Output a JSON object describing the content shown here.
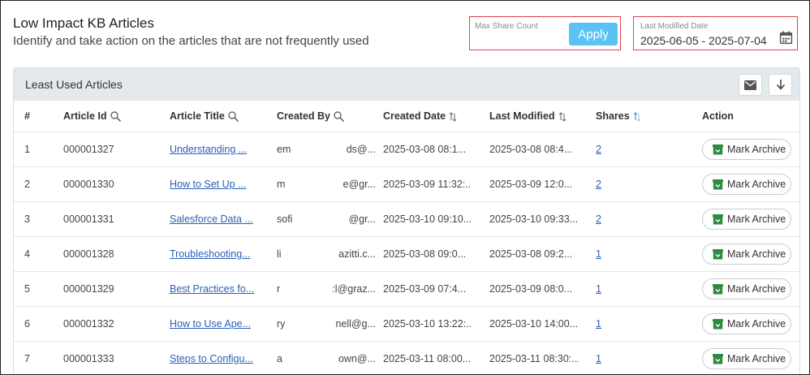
{
  "header": {
    "title": "Low Impact KB Articles",
    "subtitle": "Identify and take action on the articles that are not frequently used"
  },
  "filters": {
    "max_share_label": "Max Share Count",
    "max_share_value": "",
    "apply_label": "Apply",
    "date_label": "Last Modified Date",
    "date_range": "2025-06-05 - 2025-07-04"
  },
  "panel": {
    "title": "Least Used Articles",
    "columns": [
      "#",
      "Article Id",
      "Article Title",
      "Created By",
      "Created Date",
      "Last Modified",
      "Shares",
      "Action"
    ],
    "action_label": "Mark Archive",
    "rows": [
      {
        "num": "1",
        "id": "000001327",
        "title": "Understanding ...",
        "created_by_a": "em",
        "created_by_b": "ds@...",
        "created": "2025-03-08 08:1...",
        "modified": "2025-03-08 08:4...",
        "shares": "2"
      },
      {
        "num": "2",
        "id": "000001330",
        "title": "How to Set Up ...",
        "created_by_a": "m",
        "created_by_b": "e@gr...",
        "created": "2025-03-09 11:32:...",
        "modified": "2025-03-09 12:0...",
        "shares": "2"
      },
      {
        "num": "3",
        "id": "000001331",
        "title": "Salesforce Data ...",
        "created_by_a": "sofi",
        "created_by_b": "@gr...",
        "created": "2025-03-10 09:10...",
        "modified": "2025-03-10 09:33...",
        "shares": "2"
      },
      {
        "num": "4",
        "id": "000001328",
        "title": "Troubleshooting...",
        "created_by_a": "li",
        "created_by_b": "azitti.c...",
        "created": "2025-03-08 09:0...",
        "modified": "2025-03-08 09:2...",
        "shares": "1"
      },
      {
        "num": "5",
        "id": "000001329",
        "title": "Best Practices fo...",
        "created_by_a": "r",
        "created_by_b": ":l@graz...",
        "created": "2025-03-09 07:4...",
        "modified": "2025-03-09 08:0...",
        "shares": "1"
      },
      {
        "num": "6",
        "id": "000001332",
        "title": "How to Use Ape...",
        "created_by_a": "ry",
        "created_by_b": "nell@g...",
        "created": "2025-03-10 13:22:...",
        "modified": "2025-03-10 14:00...",
        "shares": "1"
      },
      {
        "num": "7",
        "id": "000001333",
        "title": "Steps to Configu...",
        "created_by_a": "a",
        "created_by_b": "own@...",
        "created": "2025-03-11 08:00...",
        "modified": "2025-03-11 08:30:...",
        "shares": "1"
      }
    ]
  },
  "icons": {
    "search": "search-icon",
    "sort": "sort-icon",
    "calendar": "calendar-icon",
    "email": "email-icon",
    "download": "download-icon",
    "archive": "archive-icon"
  },
  "colors": {
    "apply_button": "#5bc3f4",
    "highlight_border": "#e0404a",
    "panel_header": "#e3e9ec",
    "link": "#2a5fb8",
    "archive_icon": "#2e8b3e",
    "sort_active": "#3a9be0"
  }
}
